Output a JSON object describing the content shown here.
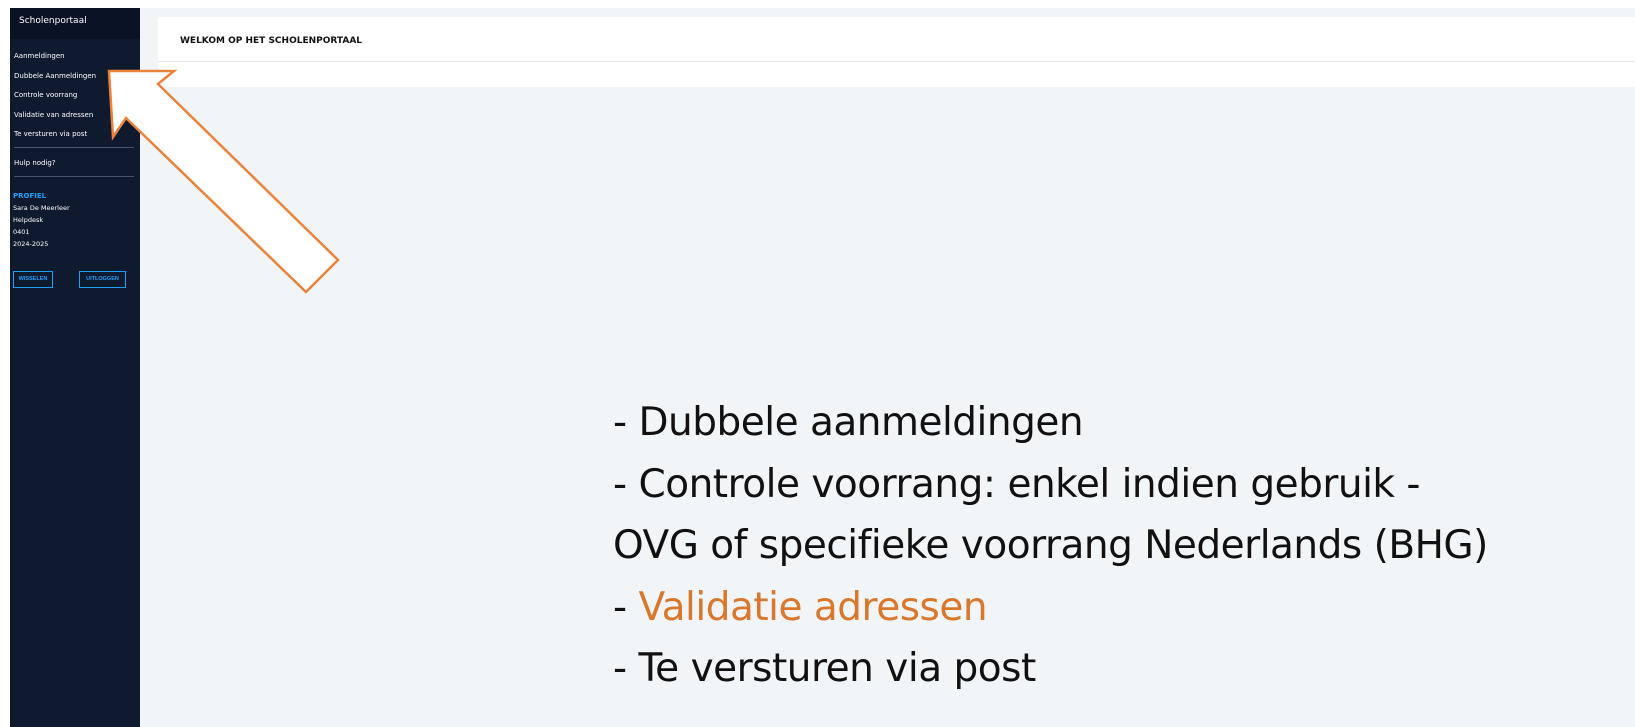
{
  "sidebar": {
    "title": "Scholenportaal",
    "items": [
      {
        "label": "Aanmeldingen"
      },
      {
        "label": "Dubbele Aanmeldingen"
      },
      {
        "label": "Controle voorrang"
      },
      {
        "label": "Validatie van adressen"
      },
      {
        "label": "Te versturen via post"
      }
    ],
    "help_label": "Hulp nodig?",
    "profile": {
      "title": "PROFIEL",
      "name": "Sara De Meerleer",
      "role": "Helpdesk",
      "code": "0401",
      "year": "2024-2025"
    },
    "buttons": {
      "switch_label": "WISSELEN",
      "logout_label": "UITLOGGEN"
    }
  },
  "main": {
    "title": "WELKOM OP HET SCHOLENPORTAAL"
  },
  "annotation": {
    "arrow_color": "#e9823a",
    "lines": [
      {
        "prefix": "- ",
        "text": "Dubbele aanmeldingen"
      },
      {
        "prefix": "- ",
        "text": "Controle voorrang: enkel indien gebruik -"
      },
      {
        "prefix": "",
        "text": "OVG of specifieke voorrang Nederlands (BHG)"
      },
      {
        "prefix": "- ",
        "text": "Validatie adressen",
        "accent": true
      },
      {
        "prefix": "- ",
        "text": "Te versturen via post"
      }
    ],
    "accent_color": "#d9782d"
  },
  "colors": {
    "sidebar_bg": "#0f1a2f",
    "profile_accent": "#1aa0ff",
    "content_bg": "#f2f5f8"
  }
}
